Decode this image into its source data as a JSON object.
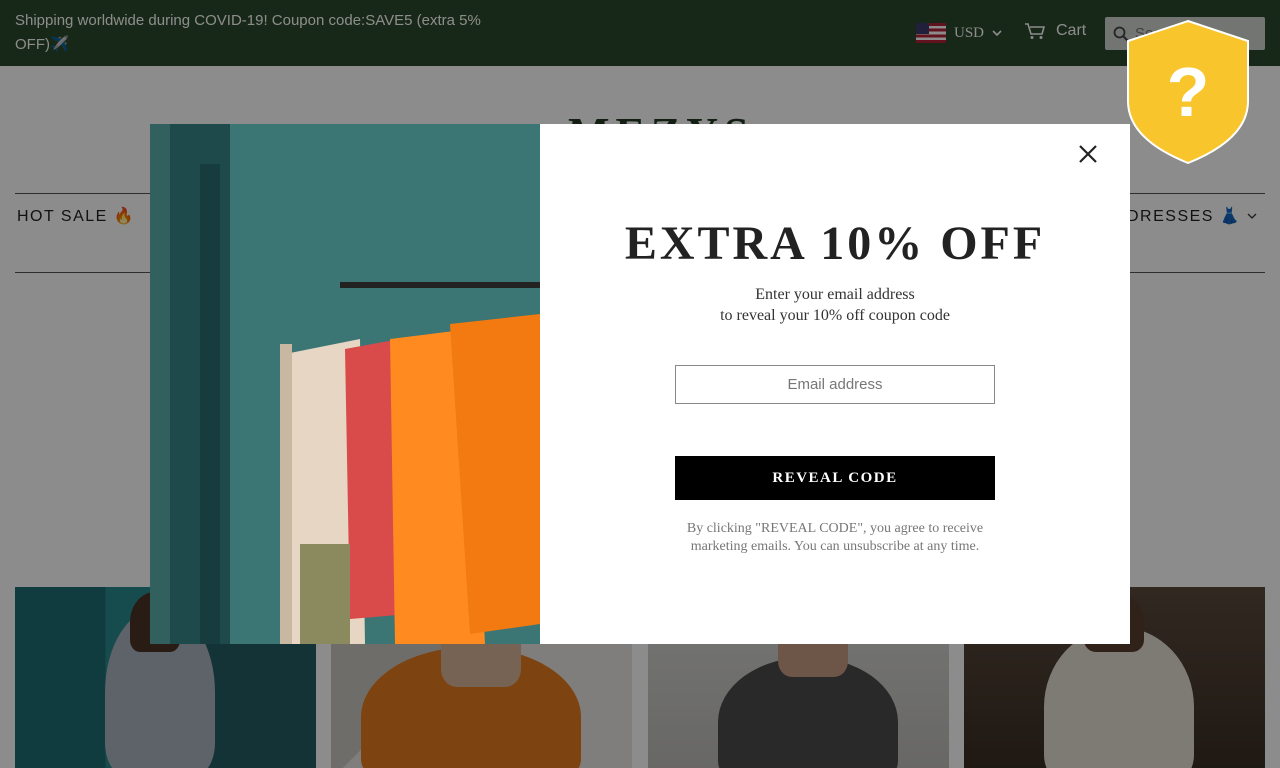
{
  "topbar": {
    "announcement": "Shipping worldwide during COVID-19! Coupon code:SAVE5 (extra 5% OFF)✈️",
    "currency": "USD",
    "cart_label": "Cart",
    "search_placeholder": "Search"
  },
  "header": {
    "logo": "MEZYS"
  },
  "nav": {
    "items": [
      {
        "label": "HOT SALE 🔥"
      },
      {
        "label": "DRESSES 👗"
      }
    ]
  },
  "popup": {
    "headline": "EXTRA 10% OFF",
    "subtitle_line1": "Enter your email address",
    "subtitle_line2": "to reveal your 10% off coupon code",
    "email_placeholder": "Email address",
    "button_label": "REVEAL CODE",
    "legal": "By clicking \"REVEAL CODE\", you agree to receive marketing emails. You can unsubscribe at any time."
  },
  "colors": {
    "topbar_bg": "#2d4a2c",
    "button_bg": "#000000",
    "shield": "#f9c52c"
  },
  "badge": {
    "icon": "question-shield-icon",
    "glyph": "?"
  }
}
